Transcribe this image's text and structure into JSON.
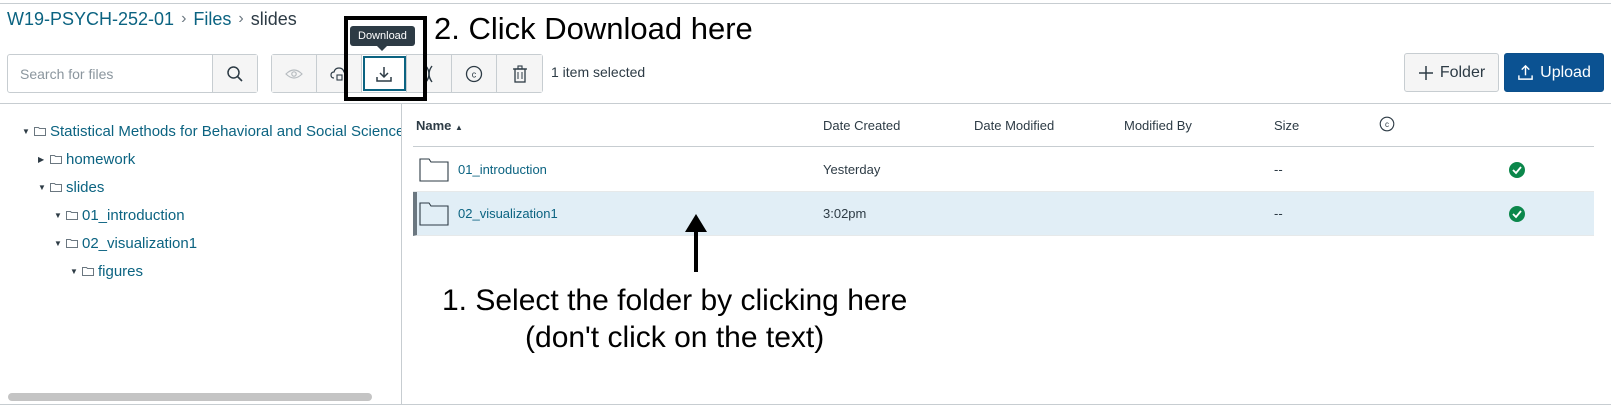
{
  "breadcrumb": {
    "course": "W19-PSYCH-252-01",
    "files": "Files",
    "current": "slides"
  },
  "search": {
    "placeholder": "Search for files"
  },
  "toolbar": {
    "buttons": [
      "view-icon",
      "publish-cloud-icon",
      "download-icon",
      "move-icon",
      "copyright-icon",
      "trash-icon"
    ],
    "tooltip": "Download",
    "selected_count": "1 item selected"
  },
  "actions": {
    "folder_label": "Folder",
    "upload_label": "Upload"
  },
  "annotations": {
    "step2": "2. Click Download here",
    "step1_line1": "1. Select the folder by clicking here",
    "step1_line2": "(don't click on the text)"
  },
  "tree": [
    {
      "label": "Statistical Methods for Behavioral and Social Sciences",
      "expanded": true
    },
    {
      "label": "homework",
      "expanded": false
    },
    {
      "label": "slides",
      "expanded": true
    },
    {
      "label": "01_introduction",
      "expanded": true
    },
    {
      "label": "02_visualization1",
      "expanded": true
    },
    {
      "label": "figures",
      "expanded": true
    }
  ],
  "table": {
    "headers": {
      "name": "Name",
      "created": "Date Created",
      "modified": "Date Modified",
      "modified_by": "Modified By",
      "size": "Size"
    },
    "sort_indicator": "▲",
    "rows": [
      {
        "name": "01_introduction",
        "created": "Yesterday",
        "modified": "",
        "modified_by": "",
        "size": "--",
        "published": true,
        "selected": false
      },
      {
        "name": "02_visualization1",
        "created": "3:02pm",
        "modified": "",
        "modified_by": "",
        "size": "--",
        "published": true,
        "selected": true
      }
    ]
  },
  "colors": {
    "link": "#0b6381",
    "upload_bg": "#0b5292",
    "selected_row": "#e1eef6",
    "published": "#0b874b"
  }
}
